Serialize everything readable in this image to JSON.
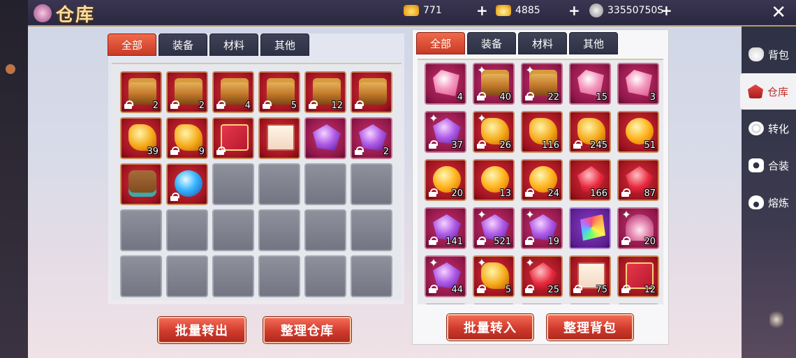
{
  "header": {
    "title": "仓库",
    "resources": [
      {
        "name": "gold",
        "icon": "gold-coin-icon",
        "value": "771"
      },
      {
        "name": "ingot",
        "icon": "gold-ingot-icon",
        "value": "4885"
      },
      {
        "name": "silver",
        "icon": "silver-coin-icon",
        "value": "33550750S"
      }
    ],
    "close": "✕"
  },
  "warehouse": {
    "tabs": [
      "全部",
      "装备",
      "材料",
      "其他"
    ],
    "active_tab": 0,
    "items": [
      {
        "icon": "treasure-chest-icon",
        "count": "2",
        "locked": true
      },
      {
        "icon": "treasure-chest-icon",
        "count": "2",
        "locked": true
      },
      {
        "icon": "treasure-chest-icon",
        "count": "4",
        "locked": true
      },
      {
        "icon": "treasure-chest-icon",
        "count": "5",
        "locked": true
      },
      {
        "icon": "treasure-chest-icon",
        "count": "12",
        "locked": true
      },
      {
        "icon": "treasure-chest-icon",
        "count": "",
        "locked": true
      },
      {
        "icon": "gold-ore-icon",
        "count": "39",
        "locked": false
      },
      {
        "icon": "gold-ore-icon",
        "count": "9",
        "locked": true
      },
      {
        "icon": "red-envelope-icon",
        "count": "",
        "locked": true
      },
      {
        "icon": "scroll-icon",
        "count": "",
        "locked": false
      },
      {
        "icon": "purple-crystal-icon",
        "count": "",
        "locked": false
      },
      {
        "icon": "purple-crystal-icon",
        "count": "2",
        "locked": true
      },
      {
        "icon": "blue-treasure-chest-icon",
        "count": "",
        "locked": false
      },
      {
        "icon": "blue-orb-icon",
        "count": "",
        "locked": true
      }
    ],
    "buttons": {
      "transfer_out": "批量转出",
      "organize": "整理仓库"
    }
  },
  "backpack": {
    "tabs": [
      "全部",
      "装备",
      "材料",
      "其他"
    ],
    "active_tab": 0,
    "items": [
      {
        "icon": "pink-gem-icon",
        "count": "4",
        "locked": false,
        "spark": false
      },
      {
        "icon": "gem-cluster-icon",
        "count": "40",
        "locked": true,
        "spark": true
      },
      {
        "icon": "gem-cluster-icon",
        "count": "22",
        "locked": true,
        "spark": true
      },
      {
        "icon": "pink-gem-icon",
        "count": "15",
        "locked": false,
        "spark": false
      },
      {
        "icon": "pink-gem-icon",
        "count": "3",
        "locked": false,
        "spark": false
      },
      {
        "icon": "purple-crystal-icon",
        "count": "37",
        "locked": true,
        "spark": true
      },
      {
        "icon": "gold-ore-icon",
        "count": "26",
        "locked": true,
        "spark": true
      },
      {
        "icon": "gold-ore-icon",
        "count": "116",
        "locked": false,
        "spark": false
      },
      {
        "icon": "gold-ore-icon",
        "count": "245",
        "locked": true,
        "spark": false
      },
      {
        "icon": "gold-orb-icon",
        "count": "51",
        "locked": false,
        "spark": false
      },
      {
        "icon": "gold-orb-icon",
        "count": "20",
        "locked": true,
        "spark": false
      },
      {
        "icon": "gold-orb-icon",
        "count": "13",
        "locked": false,
        "spark": false
      },
      {
        "icon": "gold-orb-icon",
        "count": "24",
        "locked": true,
        "spark": false
      },
      {
        "icon": "ruby-icon",
        "count": "166",
        "locked": false,
        "spark": false
      },
      {
        "icon": "ruby-icon",
        "count": "87",
        "locked": true,
        "spark": false
      },
      {
        "icon": "purple-crystal-icon",
        "count": "141",
        "locked": true,
        "spark": false
      },
      {
        "icon": "purple-crystal-icon",
        "count": "521",
        "locked": true,
        "spark": true
      },
      {
        "icon": "purple-crystal-icon",
        "count": "19",
        "locked": true,
        "spark": true
      },
      {
        "icon": "rainbow-gem-icon",
        "count": "",
        "locked": false,
        "spark": false
      },
      {
        "icon": "fan-icon",
        "count": "20",
        "locked": true,
        "spark": true
      },
      {
        "icon": "purple-crystal-icon",
        "count": "44",
        "locked": true,
        "spark": true
      },
      {
        "icon": "gold-ore-icon",
        "count": "5",
        "locked": true,
        "spark": true
      },
      {
        "icon": "ruby-icon",
        "count": "25",
        "locked": true,
        "spark": true
      },
      {
        "icon": "scroll-icon",
        "count": "75",
        "locked": true,
        "spark": false
      },
      {
        "icon": "red-envelope-icon",
        "count": "12",
        "locked": true,
        "spark": false
      }
    ],
    "buttons": {
      "transfer_in": "批量转入",
      "organize": "整理背包"
    }
  },
  "sidenav": [
    {
      "label": "背包",
      "icon": "bag-icon",
      "active": false
    },
    {
      "label": "仓库",
      "icon": "warehouse-icon",
      "active": true
    },
    {
      "label": "转化",
      "icon": "swirl-icon",
      "active": false
    },
    {
      "label": "合装",
      "icon": "gear-icon",
      "active": false
    },
    {
      "label": "熔炼",
      "icon": "flame-icon",
      "active": false
    }
  ]
}
